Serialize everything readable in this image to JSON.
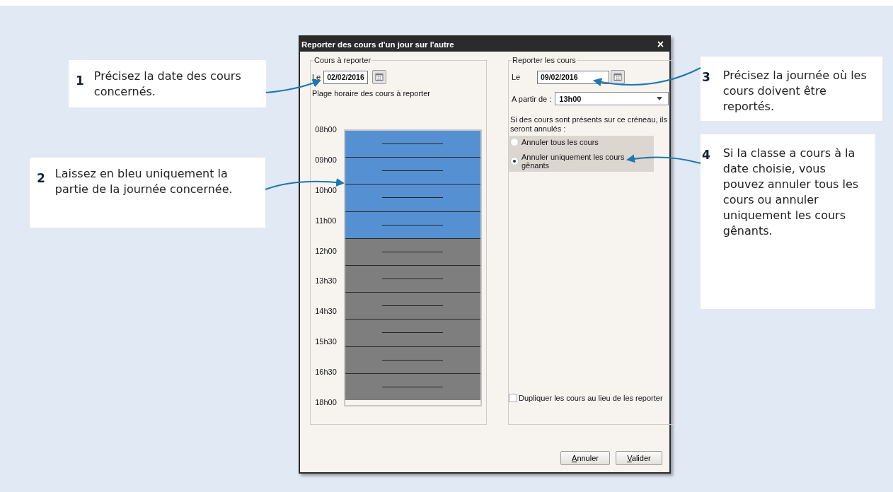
{
  "dialog": {
    "title": "Reporter des cours d'un jour sur l'autre",
    "close": "×",
    "left_group": {
      "legend": "Cours à reporter",
      "date_label": "Le",
      "date": "02/02/2016",
      "range_label": "Plage horaire des cours à reporter",
      "time_labels": [
        "08h00",
        "09h00",
        "10h00",
        "11h00",
        "12h00",
        "13h30",
        "14h30",
        "15h30",
        "16h30",
        "18h00"
      ],
      "slots": [
        {
          "selected": true
        },
        {
          "selected": true
        },
        {
          "selected": true
        },
        {
          "selected": true
        },
        {
          "selected": false
        },
        {
          "selected": false
        },
        {
          "selected": false
        },
        {
          "selected": false
        },
        {
          "selected": false
        },
        {
          "selected": false
        }
      ]
    },
    "right_group": {
      "legend": "Reporter les cours",
      "date_label": "Le",
      "date": "09/02/2016",
      "from_label": "A partir de :",
      "from_value": "13h00",
      "conflict_text": "Si des cours sont présents sur ce créneau, ils seront annulés :",
      "options": [
        {
          "label": "Annuler tous les cours",
          "selected": false
        },
        {
          "label": "Annuler uniquement les cours gênants",
          "selected": true
        }
      ],
      "duplicate": {
        "label": "Dupliquer les cours au lieu de les reporter",
        "checked": false
      }
    },
    "buttons": [
      {
        "mnemonic": "A",
        "rest": "nnuler"
      },
      {
        "mnemonic": "V",
        "rest": "alider"
      }
    ]
  },
  "callouts": [
    {
      "number": "1",
      "text": "Précisez la date des cours concernés."
    },
    {
      "number": "2",
      "text": "Laissez en bleu uniquement la partie de la journée concernée."
    },
    {
      "number": "3",
      "text": "Précisez la journée où les cours doivent être reportés."
    },
    {
      "number": "4",
      "text": "Si la classe a cours à la date choisie, vous pouvez annuler tous les cours ou annuler uniquement les cours gênants."
    }
  ]
}
